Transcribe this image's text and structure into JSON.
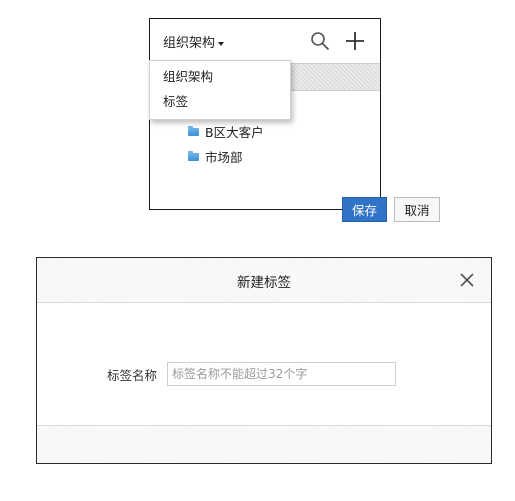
{
  "org_panel": {
    "title": "组织架构",
    "icons": [
      "search-icon",
      "plus-icon",
      "chevron-down-icon",
      "folder-icon"
    ],
    "dropdown": [
      "组织架构",
      "标签"
    ],
    "tree": [
      "B区大客户",
      "市场部"
    ]
  },
  "dialog": {
    "title": "新建标签",
    "label": "标签名称",
    "placeholder": "标签名称不能超过32个字",
    "save": "保存",
    "cancel": "取消",
    "icons": [
      "close-icon"
    ]
  },
  "colors": {
    "primary": "#2f74c8",
    "folder": "#4a9ee0"
  }
}
